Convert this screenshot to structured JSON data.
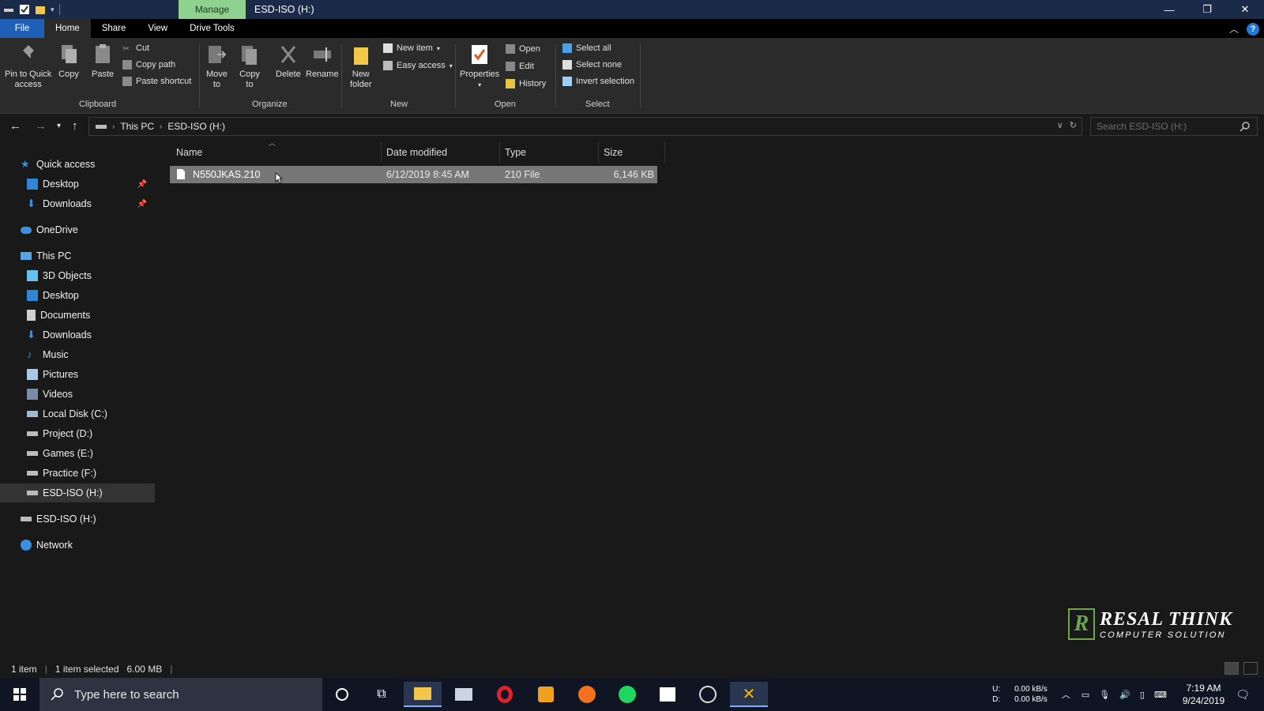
{
  "window": {
    "manage_tab": "Manage",
    "title": "ESD-ISO (H:)",
    "minimize": "—",
    "maximize": "❐",
    "close": "✕"
  },
  "ribbon_tabs": [
    "File",
    "Home",
    "Share",
    "View",
    "Drive Tools"
  ],
  "ribbon": {
    "clipboard": {
      "pin_label_1": "Pin to Quick",
      "pin_label_2": "access",
      "copy": "Copy",
      "paste": "Paste",
      "cut": "Cut",
      "copy_path": "Copy path",
      "paste_shortcut": "Paste shortcut",
      "group": "Clipboard"
    },
    "organize": {
      "move_1": "Move",
      "move_2": "to",
      "copy_1": "Copy",
      "copy_2": "to",
      "delete": "Delete",
      "rename": "Rename",
      "group": "Organize"
    },
    "new": {
      "folder_1": "New",
      "folder_2": "folder",
      "new_item": "New item",
      "easy_access": "Easy access",
      "group": "New"
    },
    "open": {
      "properties": "Properties",
      "open": "Open",
      "edit": "Edit",
      "history": "History",
      "group": "Open"
    },
    "select": {
      "select_all": "Select all",
      "select_none": "Select none",
      "invert": "Invert selection",
      "group": "Select"
    }
  },
  "address": {
    "crumbs": [
      "This PC",
      "ESD-ISO (H:)"
    ],
    "search_placeholder": "Search ESD-ISO (H:)"
  },
  "nav": {
    "items": [
      {
        "label": "Quick access",
        "icon": "star-icon"
      },
      {
        "label": "Desktop",
        "icon": "desktop-icon"
      },
      {
        "label": "Downloads",
        "icon": "download-icon"
      },
      {
        "label": "OneDrive",
        "icon": "cloud-icon"
      },
      {
        "label": "This PC",
        "icon": "computer-icon"
      },
      {
        "label": "3D Objects",
        "icon": "cube-icon"
      },
      {
        "label": "Desktop",
        "icon": "desktop-icon"
      },
      {
        "label": "Documents",
        "icon": "document-icon"
      },
      {
        "label": "Downloads",
        "icon": "download-icon"
      },
      {
        "label": "Music",
        "icon": "music-icon"
      },
      {
        "label": "Pictures",
        "icon": "pictures-icon"
      },
      {
        "label": "Videos",
        "icon": "video-icon"
      },
      {
        "label": "Local Disk (C:)",
        "icon": "drive-icon"
      },
      {
        "label": "Project (D:)",
        "icon": "drive-icon"
      },
      {
        "label": "Games (E:)",
        "icon": "drive-icon"
      },
      {
        "label": "Practice (F:)",
        "icon": "drive-icon"
      },
      {
        "label": "ESD-ISO (H:)",
        "icon": "drive-icon"
      },
      {
        "label": "ESD-ISO (H:)",
        "icon": "drive-icon"
      },
      {
        "label": "Network",
        "icon": "network-icon"
      }
    ]
  },
  "columns": [
    "Name",
    "Date modified",
    "Type",
    "Size"
  ],
  "files": [
    {
      "name": "N550JKAS.210",
      "date": "6/12/2019 8:45 AM",
      "type": "210 File",
      "size": "6,146 KB"
    }
  ],
  "status": {
    "count": "1 item",
    "selected": "1 item selected",
    "size": "6.00 MB"
  },
  "watermark": {
    "letter": "R",
    "line1": "RESAL THINK",
    "line2": "COMPUTER SOLUTION"
  },
  "taskbar": {
    "search_placeholder": "Type here to search",
    "upload_label": "U:",
    "download_label": "D:",
    "upload_speed": "0.00 kB/s",
    "download_speed": "0.00 kB/s",
    "time": "7:19 AM",
    "date": "9/24/2019"
  },
  "colors": {
    "accent": "#1f5fb8",
    "manage": "#8fd18f",
    "selection": "#777777"
  }
}
